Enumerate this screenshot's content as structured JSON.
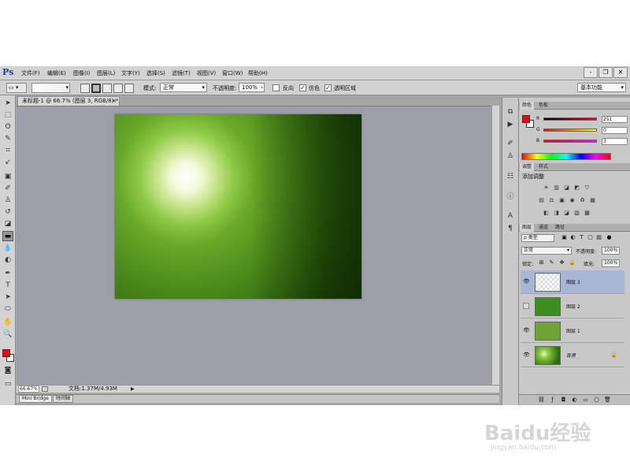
{
  "app": {
    "logo": "Ps"
  },
  "menu": [
    "文件(F)",
    "编辑(E)",
    "图像(I)",
    "图层(L)",
    "文字(Y)",
    "选择(S)",
    "滤镜(T)",
    "视图(V)",
    "窗口(W)",
    "帮助(H)"
  ],
  "window_buttons": [
    "-",
    "❐",
    "✕"
  ],
  "options": {
    "mode_label": "模式:",
    "mode_value": "正常",
    "opacity_label": "不透明度:",
    "opacity_value": "100%",
    "reverse_label": "反向",
    "reverse_checked": false,
    "dither_label": "仿色",
    "dither_checked": true,
    "transparency_label": "透明区域",
    "transparency_checked": true,
    "workspace": "基本功能"
  },
  "document": {
    "tab_title": "未标题-1 @ 66.7% (图层 3, RGB/8) *",
    "zoom": "66.67%",
    "status": "文档:1.37M/4.93M"
  },
  "bottom_tabs": [
    "Mini Bridge",
    "时间轴"
  ],
  "color_panel": {
    "tabs": [
      "颜色",
      "色板"
    ],
    "r_label": "R",
    "r_value": "251",
    "g_label": "G",
    "g_value": "0",
    "b_label": "B",
    "b_value": "3",
    "foreground": "#fb0003"
  },
  "adjust_panel": {
    "tabs": [
      "调整",
      "样式"
    ],
    "title": "添加调整"
  },
  "layers_panel": {
    "tabs": [
      "图层",
      "通道",
      "路径"
    ],
    "filter": "ρ 类型",
    "blend": "正常",
    "opacity_label": "不透明度:",
    "opacity_value": "100%",
    "lock_label": "锁定:",
    "fill_label": "填充:",
    "fill_value": "100%",
    "layers": [
      {
        "name": "图层 3",
        "visible": true,
        "selected": true
      },
      {
        "name": "图层 2",
        "visible": false,
        "selected": false
      },
      {
        "name": "图层 1",
        "visible": true,
        "selected": false
      },
      {
        "name": "背景",
        "visible": true,
        "selected": false
      }
    ]
  },
  "watermark": {
    "brand": "Baidu经验",
    "url": "jingyan.baidu.com"
  }
}
